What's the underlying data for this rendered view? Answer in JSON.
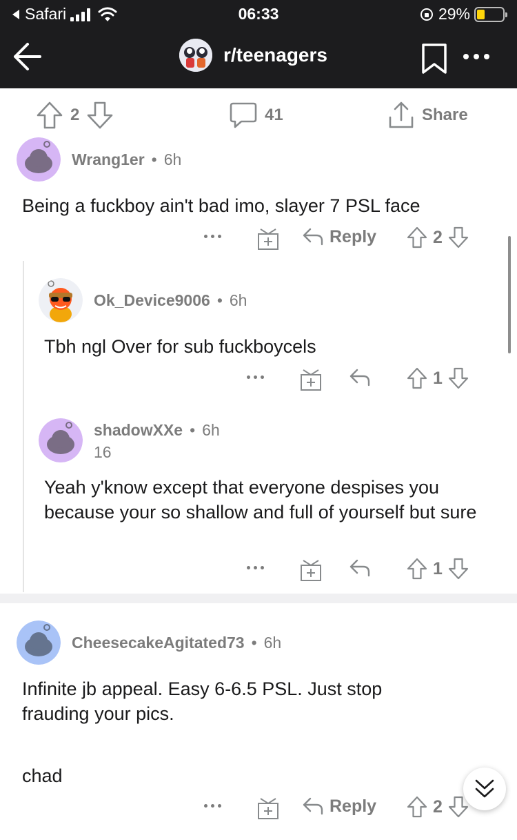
{
  "status_bar": {
    "carrier": "Safari",
    "time": "06:33",
    "battery_percent": "29%",
    "battery_level": 0.29
  },
  "header": {
    "subreddit": "r/teenagers"
  },
  "post_actions": {
    "score": "2",
    "comments": "41",
    "share_label": "Share"
  },
  "comments": [
    {
      "user": "Wrang1er",
      "time": "6h",
      "body": "Being a fuckboy ain't bad imo, slayer 7 PSL face",
      "reply_label": "Reply",
      "score": "2"
    },
    {
      "user": "Ok_Device9006",
      "time": "6h",
      "body": "Tbh ngl Over for sub fuckboycels",
      "score": "1"
    },
    {
      "user": "shadowXXe",
      "time": "6h",
      "score_line": "16",
      "body": "Yeah y'know except that everyone despises you because your so shallow and full of yourself but sure",
      "score": "1"
    },
    {
      "user": "CheesecakeAgitated73",
      "time": "6h",
      "body_line1": "Infinite jb appeal. Easy 6-6.5 PSL. Just stop frauding your pics.",
      "body_line2": "chad",
      "reply_label": "Reply",
      "score": "2"
    }
  ],
  "colors": {
    "header_bg": "#1c1c1e",
    "meta_gray": "#7c7c7c",
    "avatar_purple": "#d6b6f5",
    "avatar_blue": "#a9c3f7",
    "battery_yellow": "#ffd60a"
  }
}
